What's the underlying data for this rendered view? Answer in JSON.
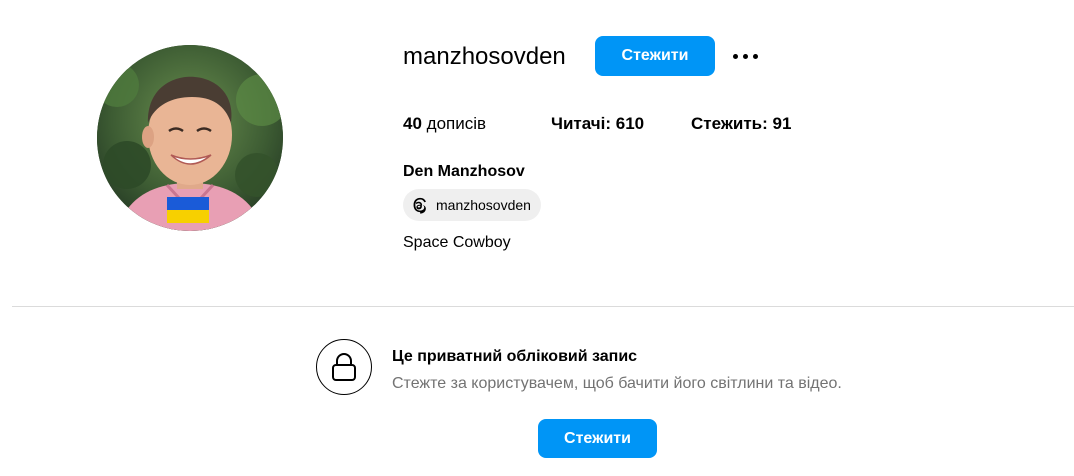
{
  "profile": {
    "username": "manzhosovden",
    "follow_label": "Стежити",
    "stats": {
      "posts_count": "40",
      "posts_label": "дописів",
      "followers_label": "Читачі:",
      "followers_count": "610",
      "following_label": "Стежить:",
      "following_count": "91"
    },
    "full_name": "Den Manzhosov",
    "threads_handle": "manzhosovden",
    "bio": "Space Cowboy"
  },
  "private": {
    "title": "Це приватний обліковий запис",
    "subtitle": "Стежте за користувачем, щоб бачити його світлини та відео.",
    "follow_label": "Стежити"
  },
  "icons": {
    "more": "more-options-icon",
    "threads": "threads-icon",
    "lock": "lock-icon"
  },
  "colors": {
    "accent": "#0095f6",
    "divider": "#dbdbdb",
    "secondary_text": "#737373",
    "badge_bg": "#efefef"
  }
}
